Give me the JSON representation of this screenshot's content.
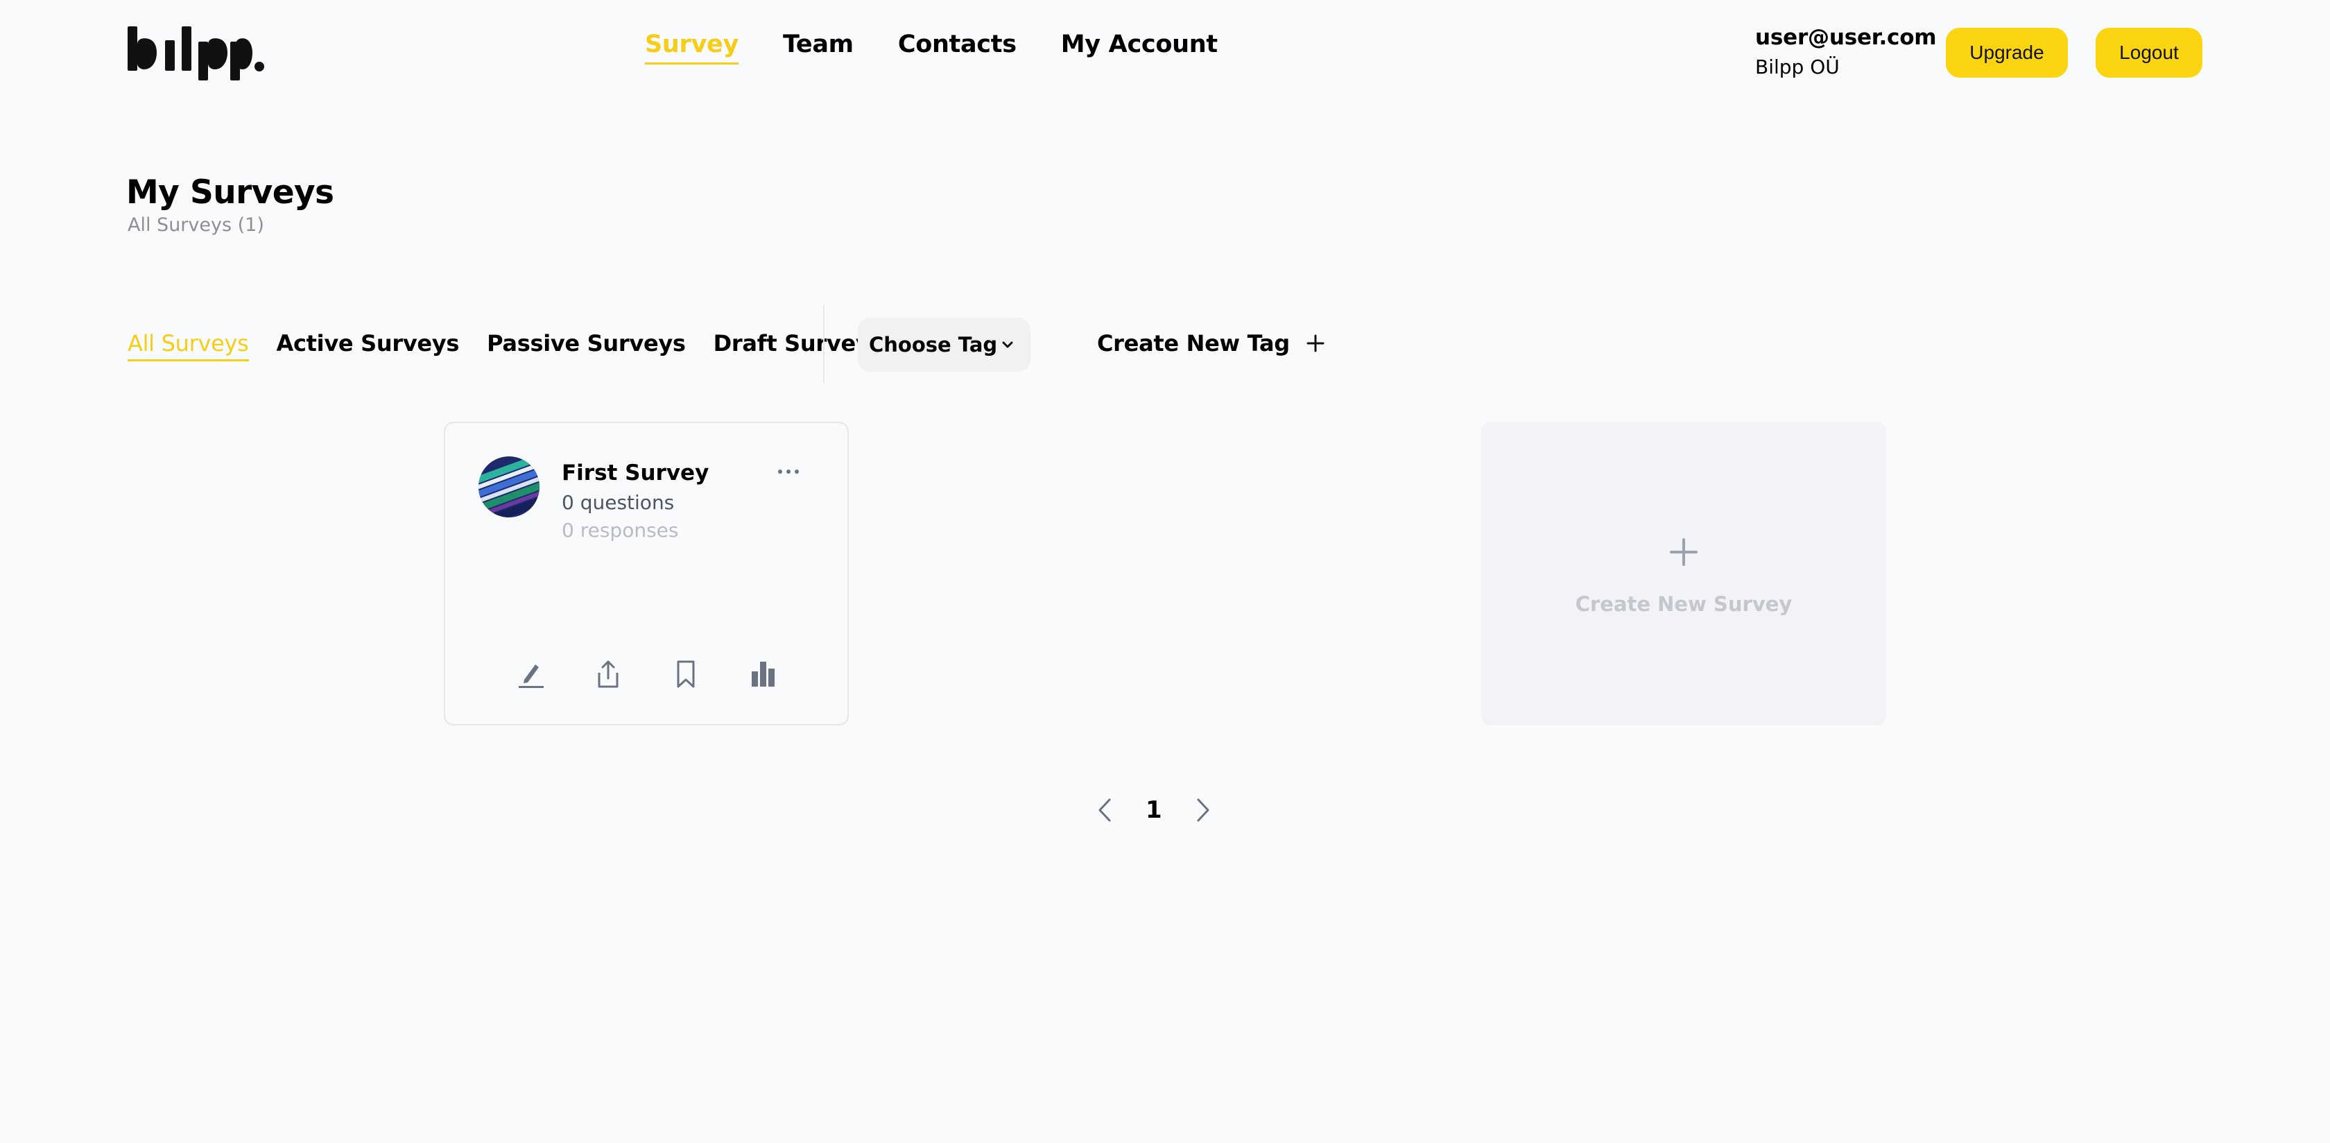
{
  "brand": {
    "logo_text": "bilpp.",
    "accent_color": "#f6cd17",
    "button_color": "#fcd512"
  },
  "nav": {
    "items": [
      {
        "label": "Survey",
        "active": true
      },
      {
        "label": "Team",
        "active": false
      },
      {
        "label": "Contacts",
        "active": false
      },
      {
        "label": "My Account",
        "active": false
      }
    ]
  },
  "user": {
    "email": "user@user.com",
    "org": "Bilpp OÜ"
  },
  "buttons": {
    "upgrade": "Upgrade",
    "logout": "Logout"
  },
  "page": {
    "title": "My Surveys",
    "subtitle": "All Surveys (1)"
  },
  "filters": {
    "tabs": [
      {
        "label": "All Surveys",
        "active": true
      },
      {
        "label": "Active Surveys",
        "active": false
      },
      {
        "label": "Passive Surveys",
        "active": false
      },
      {
        "label": "Draft Surveys",
        "active": false
      }
    ],
    "tag_select": "Choose Tag",
    "create_tag": "Create New Tag"
  },
  "surveys": [
    {
      "title": "First Survey",
      "questions": "0 questions",
      "responses": "0 responses",
      "icons": [
        "more-icon",
        "edit-icon",
        "share-icon",
        "bookmark-icon",
        "chart-icon"
      ]
    }
  ],
  "create_survey": {
    "label": "Create New Survey"
  },
  "pagination": {
    "current": "1"
  }
}
